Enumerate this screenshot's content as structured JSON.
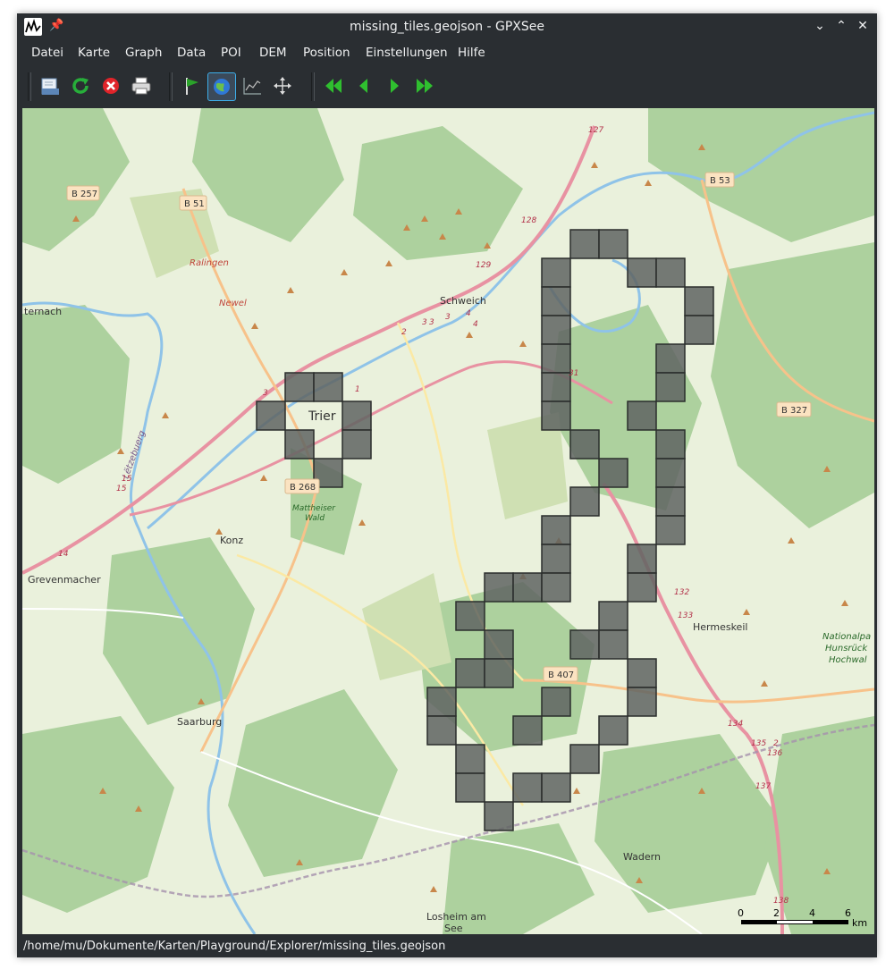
{
  "window": {
    "title": "missing_tiles.geojson - GPXSee"
  },
  "titlebar": {
    "minimize_glyph": "⌄",
    "maximize_glyph": "⌃",
    "close_glyph": "✕"
  },
  "menu": [
    "Datei",
    "Karte",
    "Graph",
    "Data",
    "POI",
    "DEM",
    "Position",
    "Einstellungen",
    "Hilfe"
  ],
  "toolbar": {
    "icons": [
      "open-file-icon",
      "reload-icon",
      "close-file-icon",
      "print-icon",
      "show-waypoints-icon",
      "show-map-icon",
      "show-graphs-icon",
      "move-icon",
      "first-icon",
      "previous-icon",
      "next-icon",
      "last-icon"
    ]
  },
  "map": {
    "places": {
      "trier": "Trier",
      "schweich": "Schweich",
      "konz": "Konz",
      "saarburg": "Saarburg",
      "hermeskeil": "Hermeskeil",
      "wadern": "Wadern",
      "grevenmacher": "Grevenmacher",
      "ternach": "ternach",
      "ralingen": "Ralingen",
      "newel": "Newel",
      "mattheiser1": "Mattheiser",
      "mattheiser2": "Wald",
      "letzeburg": "Lëtzebuerg",
      "losheim1": "Losheim am",
      "losheim2": "See",
      "nationalpark1": "Nationalpa",
      "nationalpark2": "Hunsrück",
      "nationalpark3": "Hochwal"
    },
    "roads": {
      "b257": "B 257",
      "b51": "B 51",
      "b53": "B 53",
      "b327": "B 327",
      "b268": "B 268",
      "b407": "B 407"
    },
    "exits": [
      "127",
      "128",
      "129",
      "3",
      "3",
      "2",
      "4",
      "4",
      "3",
      "1",
      "3",
      "31",
      "15",
      "15",
      "14",
      "132",
      "133",
      "134",
      "135",
      "2",
      "136",
      "137",
      "138"
    ],
    "scale": {
      "ticks": [
        "0",
        "2",
        "4",
        "6"
      ],
      "unit": "km"
    }
  },
  "status": {
    "path": "/home/mu/Dokumente/Karten/Playground/Explorer/missing_tiles.geojson"
  },
  "colors": {
    "chrome": "#2a2e32",
    "text": "#eff0f1",
    "accent": "#3daee9",
    "tile_fill": "#5f6461",
    "map_base": "#eaf1dc",
    "forest": "#add19e",
    "motorway": "#e892a2"
  }
}
